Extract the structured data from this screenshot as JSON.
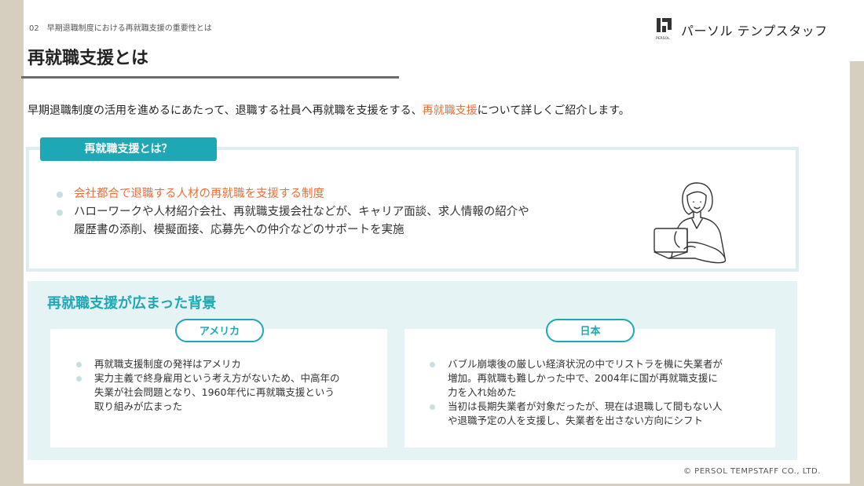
{
  "header": {
    "section_label": "02　早期退職制度における再就職支援の重要性とは",
    "page_title": "再就職支援とは",
    "logo_mark_text": "PERSOL",
    "logo_text": "パーソル テンプスタッフ"
  },
  "intro": {
    "before": "早期退職制度の活用を進めるにあたって、退職する社員へ再就職を支援をする、",
    "highlight": "再就職支援",
    "after": "について詳しくご紹介します。"
  },
  "definition": {
    "tab_label": "再就職支援とは？",
    "bullets": [
      "会社都合で退職する人材の再就職を支援する制度",
      "ハローワークや人材紹介会社、再就職支援会社などが、キャリア面談、求人情報の紹介や",
      "履歴書の添削、模擬面接、応募先への仲介などのサポートを実施"
    ]
  },
  "background": {
    "title": "再就職支援が広まった背景",
    "america": {
      "label": "アメリカ",
      "items": [
        [
          "再就職支援制度の発祥はアメリカ"
        ],
        [
          "実力主義で終身雇用という考え方がないため、中高年の",
          "失業が社会問題となり、1960年代に再就職支援という",
          "取り組みが広まった"
        ]
      ]
    },
    "japan": {
      "label": "日本",
      "items": [
        [
          "バブル崩壊後の厳しい経済状況の中でリストラを機に失業者が",
          "増加。再就職も難しかった中で、2004年に国が再就職支援に",
          "力を入れ始めた"
        ],
        [
          "当初は長期失業者が対象だったが、現在は退職して間もない人",
          "や退職予定の人を支援し、失業者を出さない方向にシフト"
        ]
      ]
    }
  },
  "footer": {
    "copyright": "© PERSOL TEMPSTAFF CO., LTD."
  },
  "colors": {
    "accent": "#1ea8b6",
    "highlight": "#e8703a",
    "panel": "#e6f3f4"
  }
}
